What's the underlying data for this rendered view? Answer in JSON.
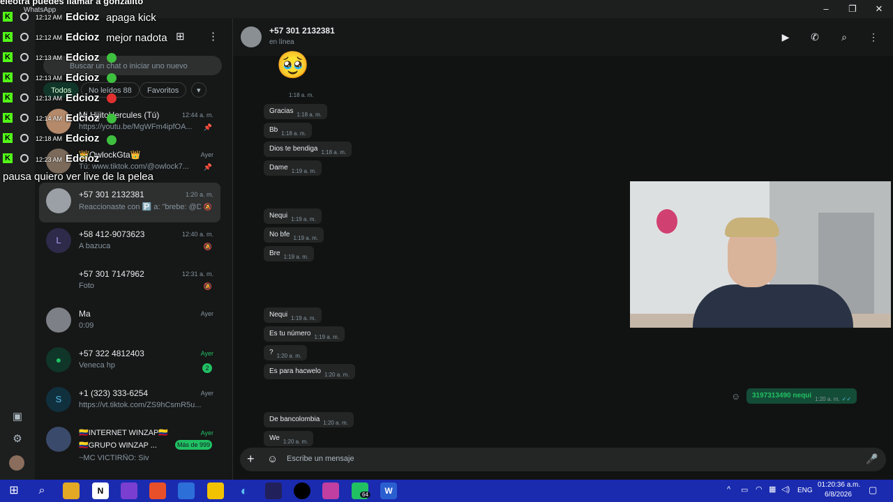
{
  "window": {
    "title": "WhatsApp"
  },
  "overlay": {
    "top_text": "eleotra puedes llamar a gonzalito",
    "messages": [
      {
        "time": "12:12 AM",
        "user": "Edcioz",
        "text": "apaga kick"
      },
      {
        "time": "12:12 AM",
        "user": "Edcioz",
        "text": "mejor nadota"
      },
      {
        "time": "12:13 AM",
        "user": "Edcioz",
        "text": ""
      },
      {
        "time": "12:13 AM",
        "user": "Edcioz",
        "text": ""
      },
      {
        "time": "12:13 AM",
        "user": "Edcioz",
        "text": ""
      },
      {
        "time": "12:14 AM",
        "user": "Edcioz",
        "text": ""
      },
      {
        "time": "12:18 AM",
        "user": "Edcioz",
        "text": ""
      },
      {
        "time": "12:23 AM",
        "user": "Edcioz",
        "text": ""
      }
    ],
    "bottom_text": "pausa quiero ver live de la pelea"
  },
  "sidebar": {
    "search_placeholder": "Buscar un chat o iniciar uno nuevo",
    "filters": [
      "Todos",
      "No leídos 88",
      "Favoritos"
    ],
    "chats": [
      {
        "name": "Mi HijitoHercules (Tú)",
        "time": "12:44 a. m.",
        "preview": "https://youtu.be/MgWFm4ipfOA...",
        "pinned": true
      },
      {
        "name": "👑OwlockGta👑",
        "time": "Ayer",
        "preview": "Tú: www.tiktok.com/@owlock7...",
        "pinned": true
      },
      {
        "name": "+57 301 2132381",
        "time": "1:20 a. m.",
        "preview": "Reaccionaste con 🅿️ a: \"brebe: @D...",
        "muted": true
      },
      {
        "name": "+58 412-9073623",
        "time": "12:40 a. m.",
        "preview": "A bazuca",
        "muted": true
      },
      {
        "name": "+57 301 7147962",
        "time": "12:31 a. m.",
        "preview": "Foto",
        "muted": true
      },
      {
        "name": "Ma",
        "time": "Ayer",
        "preview": "0:09"
      },
      {
        "name": "+57 322 4812403",
        "time": "Ayer",
        "preview": "Veneca hp",
        "unread": "2"
      },
      {
        "name": "+1 (323) 333-6254",
        "time": "Ayer",
        "preview": "https://vt.tiktok.com/ZS9hCsmR5u..."
      },
      {
        "name": "🇨🇴INTERNET WINZAP🇨🇴",
        "time": "Ayer",
        "preview": "🇨🇴GRUPO WINZAP ...",
        "unread": "Más de 999",
        "sub": "~MC VICTIRÑO: Siv"
      }
    ]
  },
  "chat": {
    "contact_name": "+57 301 2132381",
    "contact_status": "en línea",
    "composer_placeholder": "Escribe un mensaje",
    "messages": [
      {
        "text": "",
        "time": "1:18 a. m."
      },
      {
        "text": "Gracias",
        "time": "1:18 a. m."
      },
      {
        "text": "Bb",
        "time": "1:18 a. m."
      },
      {
        "text": "Dios te bendiga",
        "time": "1:18 a. m."
      },
      {
        "text": "Dame",
        "time": "1:19 a. m."
      },
      {
        "text": "Nequi",
        "time": "1:19 a. m."
      },
      {
        "text": "No bfe",
        "time": "1:19 a. m."
      },
      {
        "text": "Bre",
        "time": "1:19 a. m."
      },
      {
        "text": "Nequi",
        "time": "1:19 a. m."
      },
      {
        "text": "Es tu número",
        "time": "1:19 a. m."
      },
      {
        "text": "?",
        "time": "1:20 a. m."
      },
      {
        "text": "Es para hacwelo",
        "time": "1:20 a. m."
      },
      {
        "text": "De bancolombia",
        "time": "1:20 a. m."
      },
      {
        "text": "We",
        "time": "1:20 a. m."
      }
    ],
    "outgoing": {
      "text": "3197313490 nequi",
      "time": "1:20 a. m."
    },
    "emoji": "🥹"
  },
  "taskbar": {
    "whatsapp_badge": "64",
    "language": "ENG",
    "time": "01:20:36 a.m.",
    "date": "6/8/2026"
  },
  "colors": {
    "accent": "#21c063",
    "kick": "#53fc18",
    "taskbar": "#1a2bb0"
  }
}
